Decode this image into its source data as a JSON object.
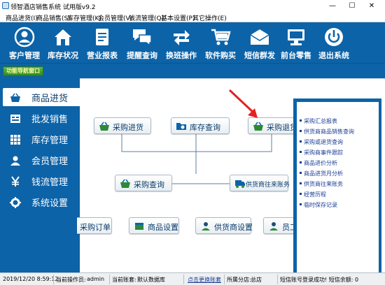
{
  "window": {
    "title": "领智酒店销售系统 试用版v9.2",
    "minimize": "—",
    "maximize": "☐",
    "close": "✕"
  },
  "menu": [
    "商品进货(I)",
    "商品销售(S)",
    "库存管理(K)",
    "会员管理(V)",
    "钱流管理(Q)",
    "基本设置(P)",
    "其它操作(E)"
  ],
  "toolbar": [
    {
      "label": "客户管理",
      "icon": "person-icon"
    },
    {
      "label": "库存状况",
      "icon": "home-icon"
    },
    {
      "label": "营业报表",
      "icon": "report-icon"
    },
    {
      "label": "提醒查询",
      "icon": "chat-icon"
    },
    {
      "label": "换班操作",
      "icon": "swap-icon"
    },
    {
      "label": "软件购买",
      "icon": "cart-icon"
    },
    {
      "label": "短信群发",
      "icon": "envelope-icon"
    },
    {
      "label": "前台零售",
      "icon": "store-icon"
    },
    {
      "label": "退出系统",
      "icon": "power-icon"
    }
  ],
  "nav_tag": "功能导航窗口",
  "sidebar": [
    {
      "label": "商品进货",
      "icon": "basket-icon",
      "active": true
    },
    {
      "label": "批发销售",
      "icon": "wholesale-icon",
      "active": false
    },
    {
      "label": "库存管理",
      "icon": "grid-icon",
      "active": false
    },
    {
      "label": "会员管理",
      "icon": "person-icon",
      "active": false
    },
    {
      "label": "钱流管理",
      "icon": "yen-icon",
      "active": false
    },
    {
      "label": "系统设置",
      "icon": "gear-icon",
      "active": false
    }
  ],
  "flow": {
    "purchase_in": "采购进货",
    "stock_query": "库存查询",
    "purchase_return": "采购退货",
    "purchase_query": "采购查询",
    "supplier_account": "供货商往来账务",
    "purchase_order": "采购订单",
    "goods_settings": "商品设置",
    "supplier_settings": "供货商设置",
    "staff_settings": "员工设置"
  },
  "reports": [
    "采购汇总报表",
    "供货商商品销售查询",
    "采购或退货查询",
    "采购商事件跟踪",
    "商品进价分析",
    "商品进货月分析",
    "供货商往来账务",
    "经营历程",
    "临时保存记录"
  ],
  "status": {
    "datetime": "2019/12/20 8:59:12",
    "operator_label": "当前操作员:",
    "operator": "admin",
    "account_label": "当前账套:",
    "account": "默认数据库",
    "switch_link": "点击更换账套",
    "branch_label": "所属分店:",
    "branch": "总店",
    "sms": "短信账号登录成功! 短信余额: 0"
  },
  "colors": {
    "primary": "#0c63a8",
    "accent_red": "#e32222",
    "link": "#1a3c94"
  }
}
